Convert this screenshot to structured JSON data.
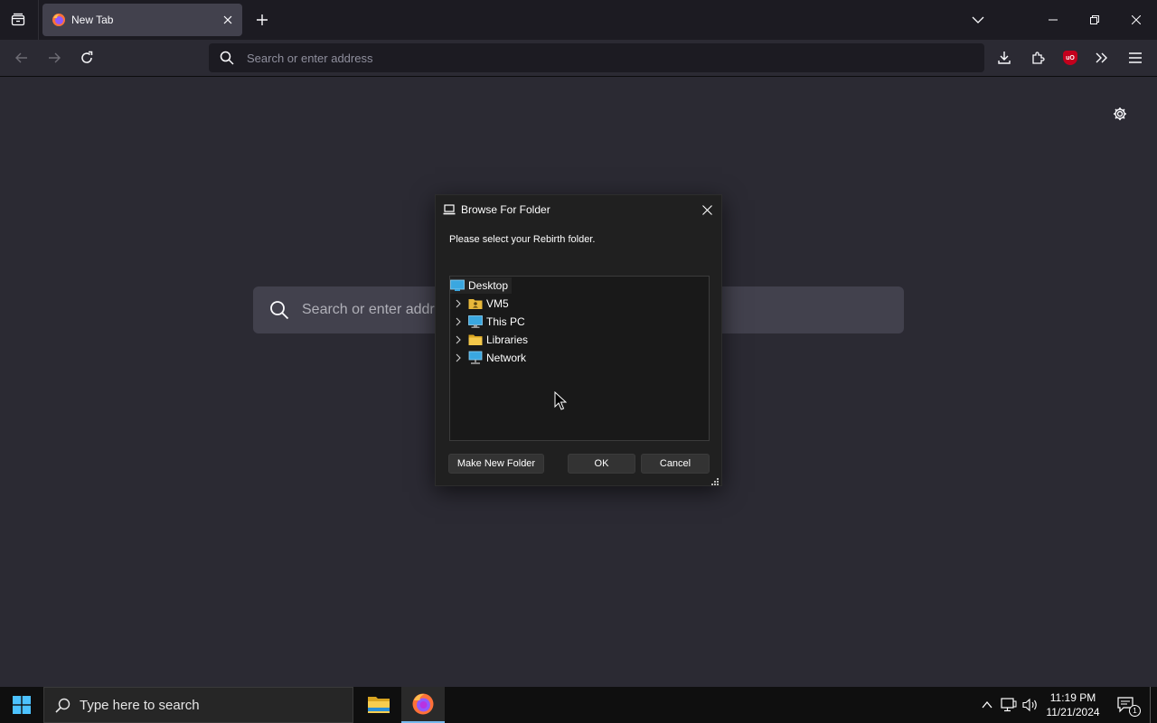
{
  "browser": {
    "tab": {
      "title": "New Tab"
    },
    "urlbar": {
      "placeholder": "Search or enter address"
    }
  },
  "newtab_page": {
    "search_placeholder": "Search or enter address"
  },
  "dialog": {
    "title": "Browse For Folder",
    "instruction": "Please select your Rebirth folder.",
    "tree": [
      {
        "label": "Desktop",
        "icon": "desktop-icon",
        "expandable": false,
        "selected": true
      },
      {
        "label": "VM5",
        "icon": "user-folder-icon",
        "expandable": true,
        "selected": false
      },
      {
        "label": "This PC",
        "icon": "computer-icon",
        "expandable": true,
        "selected": false
      },
      {
        "label": "Libraries",
        "icon": "folder-icon",
        "expandable": true,
        "selected": false
      },
      {
        "label": "Network",
        "icon": "network-icon",
        "expandable": true,
        "selected": false
      }
    ],
    "buttons": {
      "make_new_folder": "Make New Folder",
      "ok": "OK",
      "cancel": "Cancel"
    }
  },
  "taskbar": {
    "search_placeholder": "Type here to search",
    "time": "11:19 PM",
    "date": "11/21/2024",
    "notification_count": "1"
  },
  "colors": {
    "browser_bg": "#2b2a33",
    "tabstrip_bg": "#1c1b22",
    "dialog_bg": "#202020",
    "accent": "#76b9ed"
  }
}
